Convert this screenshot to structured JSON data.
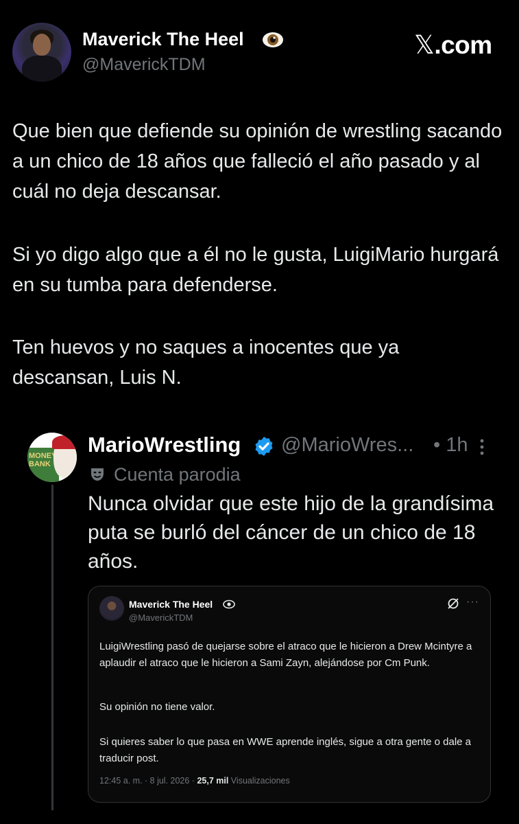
{
  "header": {
    "display_name": "Maverick The Heel",
    "name_emoji": "eye-icon",
    "handle": "@MaverickTDM",
    "brand_x": "𝕏",
    "brand_domain": ".com"
  },
  "tweet": {
    "paragraphs": [
      "Que bien que defiende su opinión de wrestling sacando a un chico de 18 años que falleció el año pasado y al cuál no deja descansar.",
      "Si yo digo algo que a él no le gusta, LuigiMario hurgará en su tumba para defenderse.",
      "Ten huevos y no saques a inocentes que ya descansan, Luis N."
    ]
  },
  "quoted": {
    "display_name": "MarioWrestling",
    "handle": "@MarioWres...",
    "time": "• 1h",
    "label": "Cuenta parodia",
    "avatar_text": "MONEY BANK",
    "text": "Nunca olvidar que este hijo de la grandísima puta se burló del cáncer de un chico de 18 años.",
    "embedded": {
      "display_name": "Maverick The Heel",
      "handle": "@MaverickTDM",
      "more": "···",
      "paragraphs": [
        "LuigiWrestling pasó de quejarse sobre el atraco que le hicieron a Drew Mcintyre a aplaudir el atraco que le hicieron a Sami Zayn, alejándose por Cm Punk.",
        "Su opinión no tiene valor.",
        "Si quieres saber lo que pasa en WWE aprende inglés, sigue a otra gente o dale a traducir post."
      ],
      "timestamp": "12:45 a. m. · 8 jul. 2026 · ",
      "views_count": "25,7 mil",
      "views_label": " Visualizaciones"
    }
  },
  "colors": {
    "background": "#000000",
    "text_primary": "#e7e9ea",
    "text_secondary": "#71767b",
    "verified_blue": "#1d9bf0",
    "card_border": "#2f3336"
  }
}
